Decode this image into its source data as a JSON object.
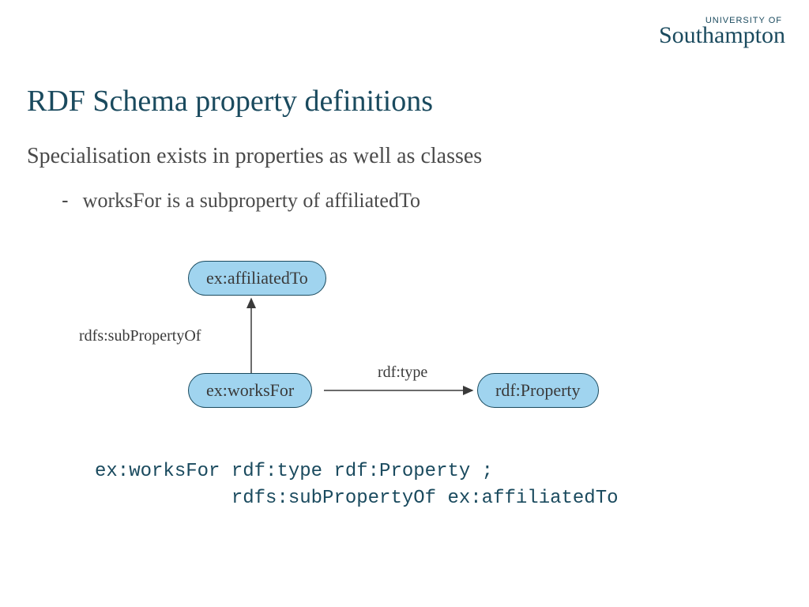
{
  "logo": {
    "small": "UNIVERSITY OF",
    "big": "Southampton"
  },
  "title": "RDF Schema property definitions",
  "subtitle": "Specialisation exists in properties as well as classes",
  "bullet": "worksFor is a subproperty of affiliatedTo",
  "diagram": {
    "nodes": {
      "affiliated": "ex:affiliatedTo",
      "worksfor": "ex:worksFor",
      "property": "rdf:Property"
    },
    "edges": {
      "subproperty": "rdfs:subPropertyOf",
      "type": "rdf:type"
    }
  },
  "code": "ex:worksFor rdf:type rdf:Property ;\n            rdfs:subPropertyOf ex:affiliatedTo"
}
